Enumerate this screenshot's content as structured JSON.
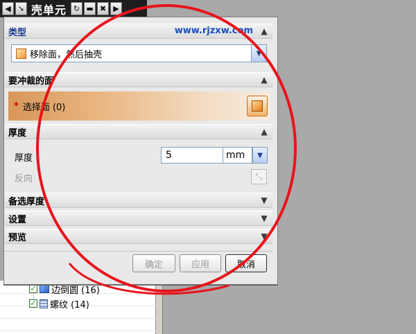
{
  "window": {
    "title": "壳单元",
    "title_buttons": [
      "back-icon",
      "pin-icon",
      "refresh-icon",
      "minimize-icon",
      "close-icon",
      "forward-icon"
    ]
  },
  "watermark": "www.rjzxw.com",
  "sections": {
    "type": {
      "header": "类型",
      "selected_value": "移除面，然后抽壳"
    },
    "faces": {
      "header": "要冲裁的面",
      "select_label": "选择面 (0)",
      "required_marker": "*"
    },
    "thickness": {
      "header": "厚度",
      "thickness_label": "厚度",
      "thickness_value": "5",
      "unit": "mm",
      "reverse_label": "反向"
    },
    "alt_thickness": {
      "header": "备选厚度"
    },
    "settings": {
      "header": "设置"
    },
    "preview": {
      "header": "预览"
    }
  },
  "buttons": {
    "ok": "确定",
    "apply": "应用",
    "cancel": "取消"
  },
  "background_tree": {
    "items": [
      {
        "label": "边倒圆 (16)"
      },
      {
        "label": "螺纹 (14)"
      }
    ]
  },
  "colors": {
    "annotation": "#e8141c",
    "selection_highlight": "#e9b682",
    "watermark": "#1a4ebf"
  }
}
